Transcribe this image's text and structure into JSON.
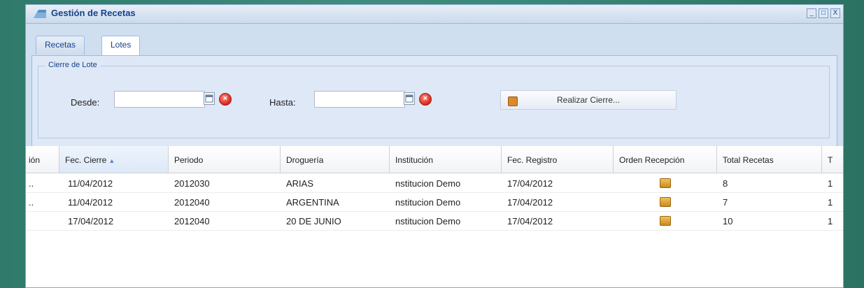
{
  "window": {
    "title": "Gestión de Recetas",
    "controls": {
      "minimize": "_",
      "maximize": "□",
      "close": "X"
    }
  },
  "tabs": [
    {
      "label": "Recetas",
      "active": false
    },
    {
      "label": "Lotes",
      "active": true
    }
  ],
  "cierre": {
    "legend": "Cierre de Lote",
    "desde_label": "Desde:",
    "desde_value": "",
    "hasta_label": "Hasta:",
    "hasta_value": "",
    "action_label": "Realizar Cierre..."
  },
  "grid": {
    "columns": [
      "ión",
      "Fec. Cierre",
      "Periodo",
      "Droguería",
      "Institución",
      "Fec. Registro",
      "Orden Recepción",
      "Total Recetas",
      "T"
    ],
    "sorted_column": "Fec. Cierre",
    "rows": [
      {
        "c0": "..",
        "fec_cierre": "11/04/2012",
        "periodo": "2012030",
        "drogueria": "ARIAS",
        "institucion": "nstitucion Demo",
        "fec_registro": "17/04/2012",
        "total": "8",
        "t": "1"
      },
      {
        "c0": "..",
        "fec_cierre": "11/04/2012",
        "periodo": "2012040",
        "drogueria": "ARGENTINA",
        "institucion": "nstitucion Demo",
        "fec_registro": "17/04/2012",
        "total": "7",
        "t": "1"
      },
      {
        "c0": "",
        "fec_cierre": "17/04/2012",
        "periodo": "2012040",
        "drogueria": "20 DE JUNIO",
        "institucion": "nstitucion Demo",
        "fec_registro": "17/04/2012",
        "total": "10",
        "t": "1"
      }
    ]
  },
  "colors": {
    "title": "#15428b",
    "panel": "#dfe8f6",
    "border": "#99bbe8",
    "background": "#3a8a79"
  },
  "icons": {
    "app": "app-folder-icon",
    "calendar": "calendar-icon",
    "clear": "clear-icon",
    "cierre": "box-icon",
    "orden": "package-icon"
  }
}
